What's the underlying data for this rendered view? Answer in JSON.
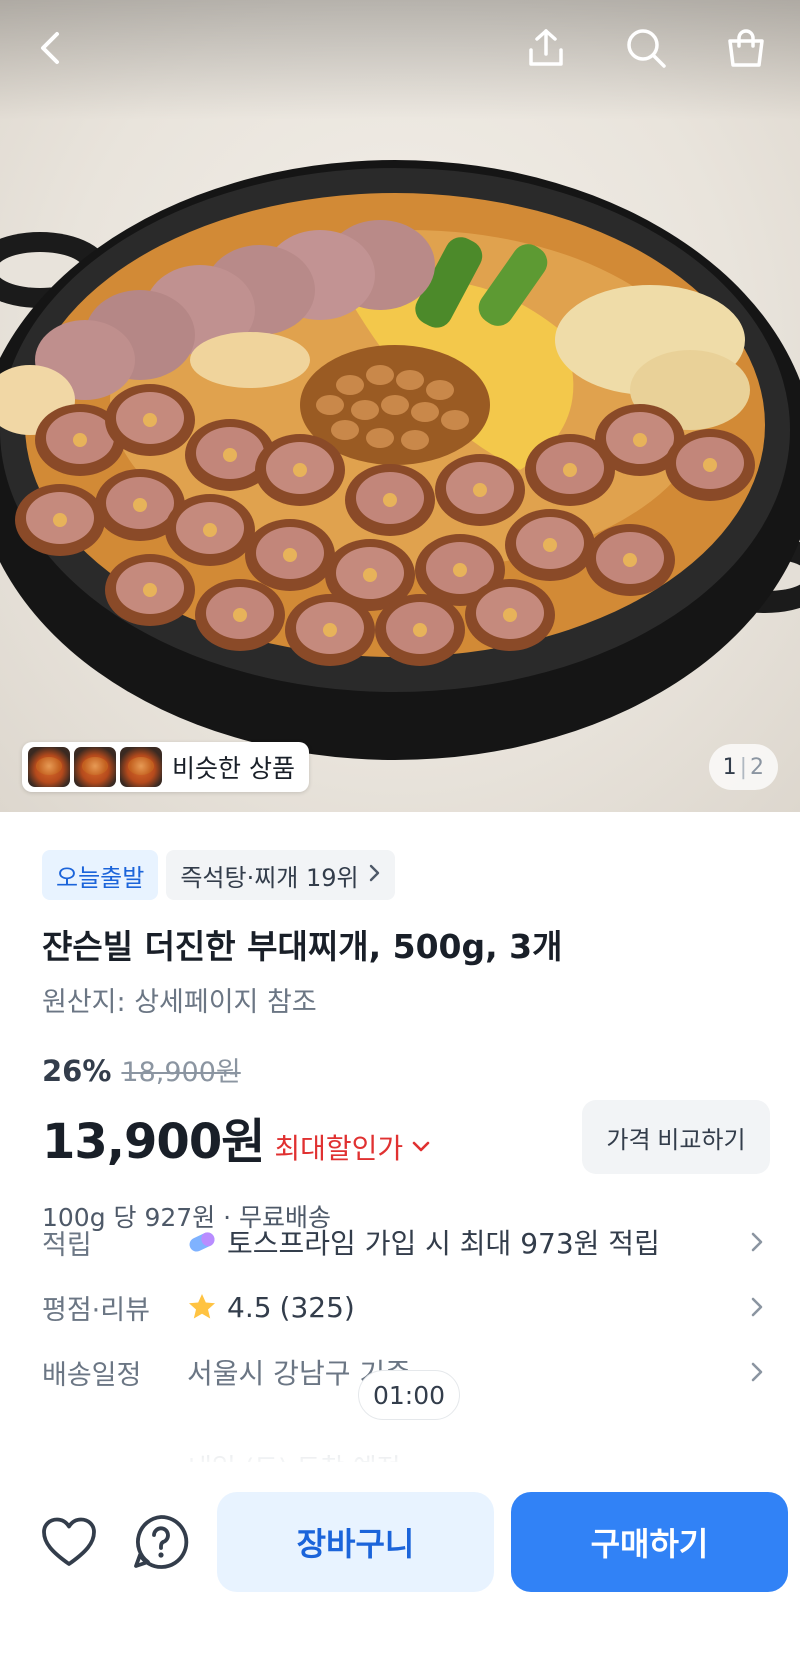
{
  "hero": {
    "similar_products_label": "비슷한 상품",
    "page_current": "1",
    "page_total": "2"
  },
  "top_bar": {
    "back_icon": "chevron-left-icon",
    "share_icon": "share-icon",
    "search_icon": "search-icon",
    "cart_icon": "shopping-bag-icon"
  },
  "product": {
    "badges": {
      "today_shipping": "오늘출발",
      "ranking": "즉석탕·찌개 19위"
    },
    "title": "쟌슨빌 더진한 부대찌개, 500g, 3개",
    "origin": "원산지: 상세페이지 참조",
    "discount_rate": "26%",
    "original_price": "18,900원",
    "price": "13,900원",
    "max_discount_label": "최대할인가",
    "compare_button": "가격 비교하기",
    "unit_price": "100g 당 927원 · 무료배송"
  },
  "details": {
    "points": {
      "label": "적립",
      "value": "토스프라임 가입 시 최대 973원 적립",
      "icon": "prime-pill-icon"
    },
    "rating": {
      "label": "평점·리뷰",
      "score": "4.5",
      "count": "(325)",
      "icon": "star-icon"
    },
    "delivery": {
      "label": "배송일정",
      "value": "서울시 강남구 기준",
      "sub": "내일 (토) 도착 예정",
      "timer": "01:00"
    }
  },
  "bottom_bar": {
    "wishlist_icon": "heart-icon",
    "inquiry_icon": "question-icon",
    "cart_button": "장바구니",
    "buy_button": "구매하기"
  },
  "colors": {
    "primary": "#3182f6",
    "primary_light": "#e8f3ff",
    "discount_red": "#e03131",
    "star": "#ffc342"
  }
}
